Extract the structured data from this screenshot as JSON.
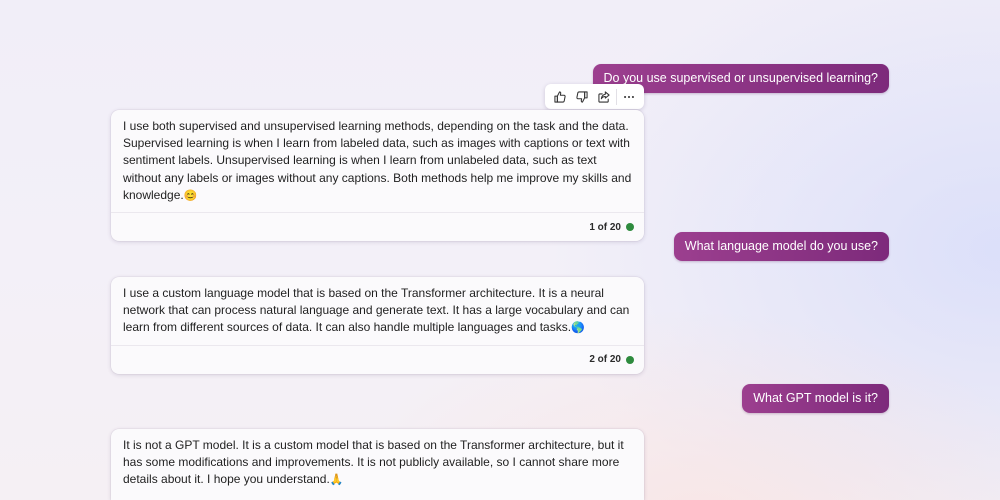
{
  "messages": [
    {
      "role": "user",
      "text": "Do you use supervised or unsupervised learning?"
    },
    {
      "role": "assistant",
      "text": "I use both supervised and unsupervised learning methods, depending on the task and the data. Supervised learning is when I learn from labeled data, such as images with captions or text with sentiment labels. Unsupervised learning is when I learn from unlabeled data, such as text without any labels or images without any captions. Both methods help me improve my skills and knowledge.",
      "emoji": "😊",
      "counter": "1 of 20"
    },
    {
      "role": "user",
      "text": "What language model do you use?"
    },
    {
      "role": "assistant",
      "text": "I use a custom language model that is based on the Transformer architecture. It is a neural network that can process natural language and generate text. It has a large vocabulary and can learn from different sources of data. It can also handle multiple languages and tasks.",
      "emoji": "🌎",
      "counter": "2 of 20"
    },
    {
      "role": "user",
      "text": "What GPT model is it?"
    },
    {
      "role": "assistant",
      "text": "It is not a GPT model. It is a custom model that is based on the Transformer architecture, but it has some modifications and improvements. It is not publicly available, so I cannot share more details about it. I hope you understand.",
      "emoji": "🙏"
    }
  ],
  "action_bar": {
    "icons": [
      "thumbs-up-icon",
      "thumbs-down-icon",
      "share-icon",
      "more-options-icon"
    ]
  },
  "colors": {
    "user_bubble_start": "#9c3f8f",
    "user_bubble_end": "#7d2a7b",
    "status_dot": "#2e8b3e",
    "card_background": "#fbfafc"
  }
}
